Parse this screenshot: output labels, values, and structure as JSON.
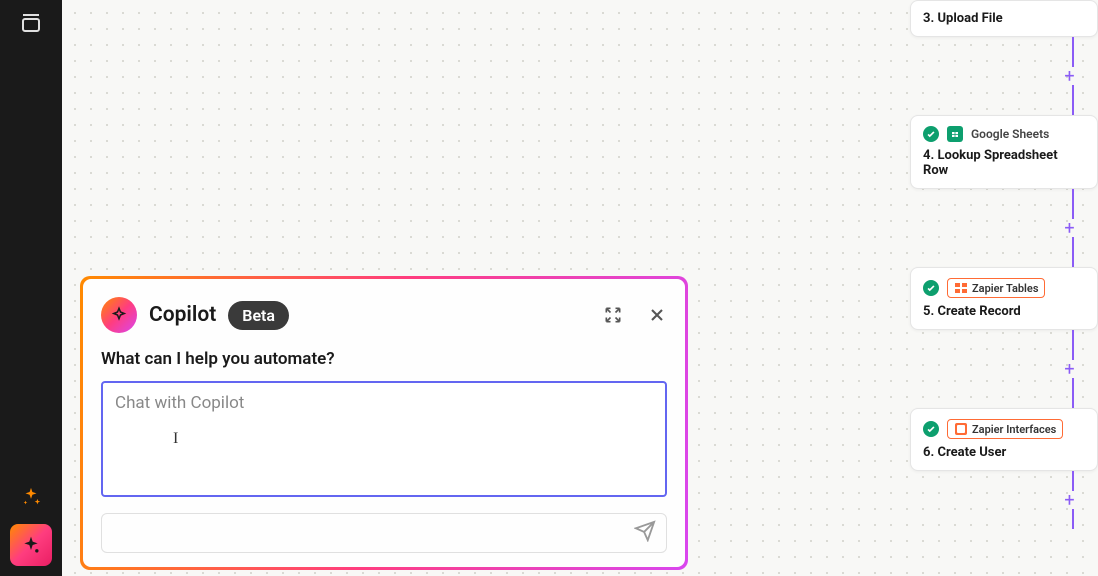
{
  "copilot": {
    "title": "Copilot",
    "badge": "Beta",
    "prompt": "What can I help you automate?",
    "placeholder": "Chat with Copilot"
  },
  "workflow": {
    "steps": [
      {
        "number": "3.",
        "action": "Upload File",
        "app": null,
        "has_badge": false
      },
      {
        "number": "4.",
        "action": "Lookup Spreadsheet Row",
        "app": "Google Sheets",
        "has_badge": false
      },
      {
        "number": "5.",
        "action": "Create Record",
        "app": "Zapier Tables",
        "has_badge": true
      },
      {
        "number": "6.",
        "action": "Create User",
        "app": "Zapier Interfaces",
        "has_badge": true
      }
    ]
  }
}
